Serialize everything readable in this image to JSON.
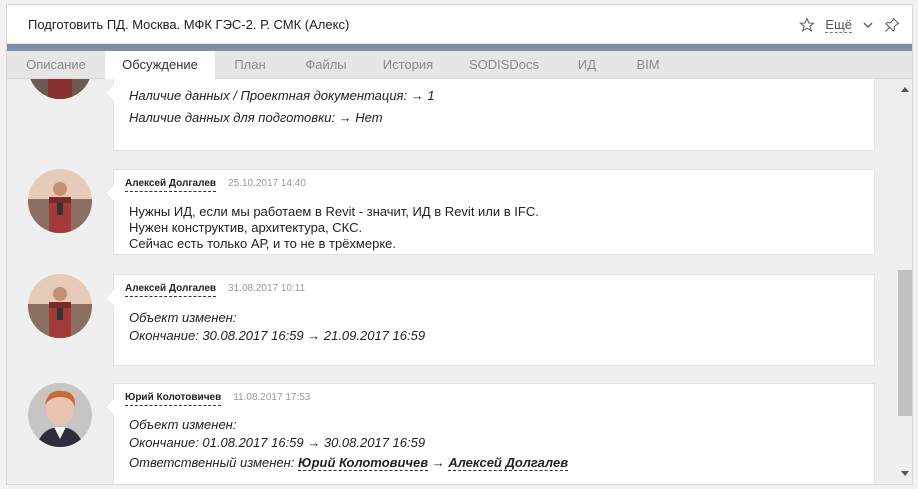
{
  "window": {
    "title": "Подготовить ПД. Москва. МФК ГЭС-2. Р. СМК (Алекс)",
    "more_label": "Ещё",
    "accent_color": "#7f8fa6"
  },
  "tabs": [
    {
      "label": "Описание",
      "active": false
    },
    {
      "label": "Обсуждение",
      "active": true
    },
    {
      "label": "План",
      "active": false
    },
    {
      "label": "Файлы",
      "active": false
    },
    {
      "label": "История",
      "active": false
    },
    {
      "label": "SODISDocs",
      "active": false
    },
    {
      "label": "ИД",
      "active": false
    },
    {
      "label": "BIM",
      "active": false
    }
  ],
  "feed": {
    "entry0": {
      "lines": [
        "Наличие данных / Проектная документация:  → 1",
        "Наличие данных для подготовки:  → Нет"
      ]
    },
    "entry1": {
      "author": "Алексей Долгалев",
      "date": "25.10.2017 14:40",
      "lines": [
        "Нужны ИД, если мы работаем в Revit - значит, ИД в Revit или в IFC.",
        "Нужен конструктив, архитектура, СКС.",
        "Сейчас есть только АР, и то не в трёхмерке."
      ]
    },
    "entry2": {
      "author": "Алексей Долгалев",
      "date": "31.08.2017 10:11",
      "lines": [
        "Объект изменен:",
        "Окончание: 30.08.2017 16:59 → 21.09.2017 16:59"
      ]
    },
    "entry3": {
      "author": "Юрий Колотовичев",
      "date": "11.08.2017 17:53",
      "lines": [
        "Объект изменен:",
        "Окончание: 01.08.2017 16:59 → 30.08.2017 16:59"
      ],
      "responsible_prefix": "Ответственный изменен:",
      "responsible_from": "Юрий Колотовичев",
      "arrow": "→",
      "responsible_to": "Алексей Долгалев"
    }
  }
}
